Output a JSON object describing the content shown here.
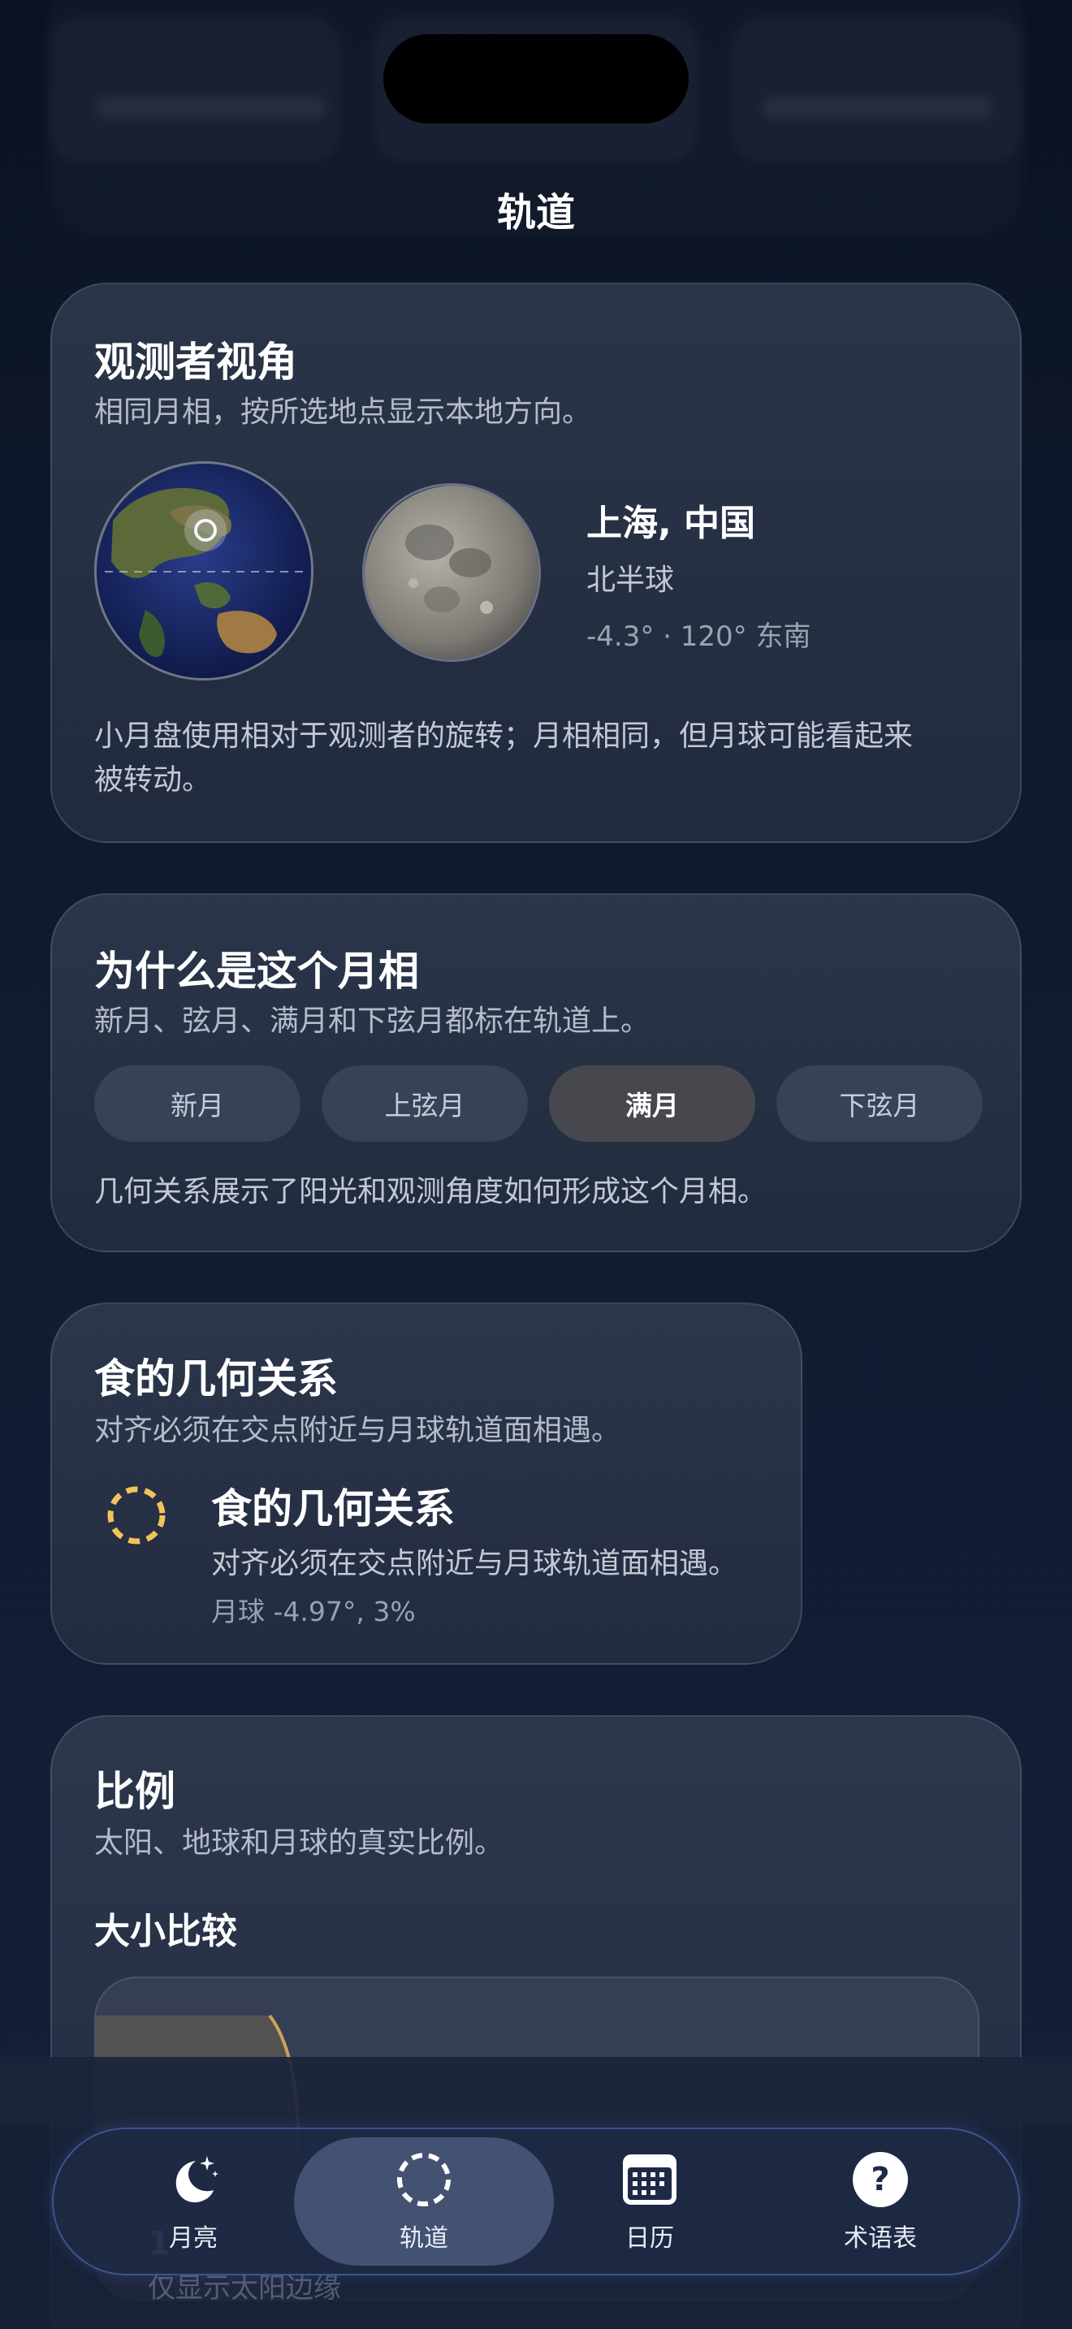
{
  "nav": {
    "title": "轨道"
  },
  "observer": {
    "title": "观测者视角",
    "subtitle": "相同月相，按所选地点显示本地方向。",
    "location": "上海, 中国",
    "hemisphere": "北半球",
    "coords": "-4.3° · 120° 东南",
    "note": "小月盘使用相对于观测者的旋转；月相相同，但月球可能看起来被转动。"
  },
  "phase": {
    "title": "为什么是这个月相",
    "subtitle": "新月、弦月、满月和下弦月都标在轨道上。",
    "options": [
      "新月",
      "上弦月",
      "满月",
      "下弦月"
    ],
    "selected": "满月",
    "note": "几何关系展示了阳光和观测角度如何形成这个月相。"
  },
  "eclipse": {
    "title": "食的几何关系",
    "subtitle": "对齐必须在交点附近与月球轨道面相遇。",
    "item_title": "食的几何关系",
    "item_subtitle": "对齐必须在交点附近与月球轨道面相遇。",
    "item_value": "月球 -4.97°, 3%",
    "icon_color": "#f2c35a"
  },
  "scale": {
    "title": "比例",
    "subtitle": "太阳、地球和月球的真实比例。",
    "size_heading": "大小比较"
  },
  "behind": {
    "note": "仅显示太阳边缘",
    "num": "1"
  },
  "tabs": [
    {
      "label": "月亮",
      "icon": "moon-stars-icon"
    },
    {
      "label": "轨道",
      "icon": "orbit-icon"
    },
    {
      "label": "日历",
      "icon": "calendar-icon"
    },
    {
      "label": "术语表",
      "icon": "question-icon"
    }
  ],
  "colors": {
    "accent": "#4a67d8",
    "eclipse": "#f2c35a",
    "background": "#101a2e"
  }
}
